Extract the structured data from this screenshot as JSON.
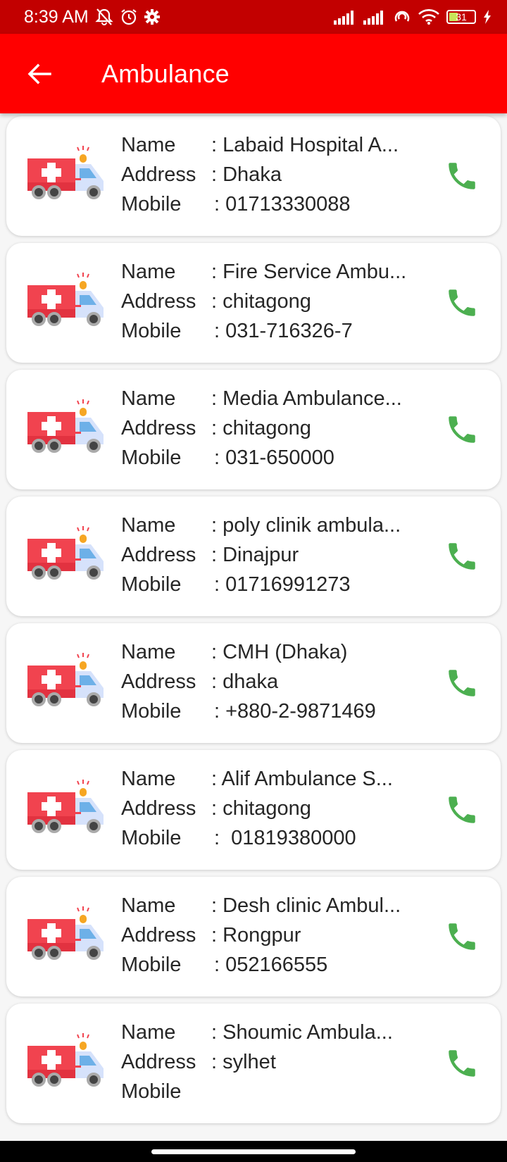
{
  "status_bar": {
    "time": "8:39 AM",
    "battery": "31",
    "icons_left": [
      "bell-muted-icon",
      "alarm-icon",
      "gear-icon"
    ],
    "icons_right": [
      "signal-icon",
      "signal-icon",
      "hotspot-icon",
      "wifi-icon",
      "battery-icon",
      "charging-icon"
    ]
  },
  "app_bar": {
    "title": "Ambulance",
    "back_icon": "arrow-left-icon"
  },
  "colors": {
    "status_bar": "#c20000",
    "app_bar": "#ff0000",
    "call_icon": "#4caf50"
  },
  "labels": {
    "name": "Name",
    "address": "Address",
    "mobile": "Mobile"
  },
  "entries": [
    {
      "name": ": Labaid Hospital A...",
      "address": ": Dhaka",
      "mobile": ": 01713330088"
    },
    {
      "name": ": Fire Service Ambu...",
      "address": ": chitagong",
      "mobile": ": 031-716326-7"
    },
    {
      "name": ": Media Ambulance...",
      "address": ": chitagong",
      "mobile": ": 031-650000"
    },
    {
      "name": ": poly clinik ambula...",
      "address": ": Dinajpur",
      "mobile": ": 01716991273"
    },
    {
      "name": ": CMH (Dhaka)",
      "address": ": dhaka",
      "mobile": ": +880-2-9871469"
    },
    {
      "name": ": Alif Ambulance S...",
      "address": ": chitagong",
      "mobile": ":  01819380000"
    },
    {
      "name": ": Desh clinic Ambul...",
      "address": ": Rongpur",
      "mobile": ": 052166555"
    },
    {
      "name": ": Shoumic Ambula...",
      "address": ": sylhet",
      "mobile": ""
    }
  ]
}
